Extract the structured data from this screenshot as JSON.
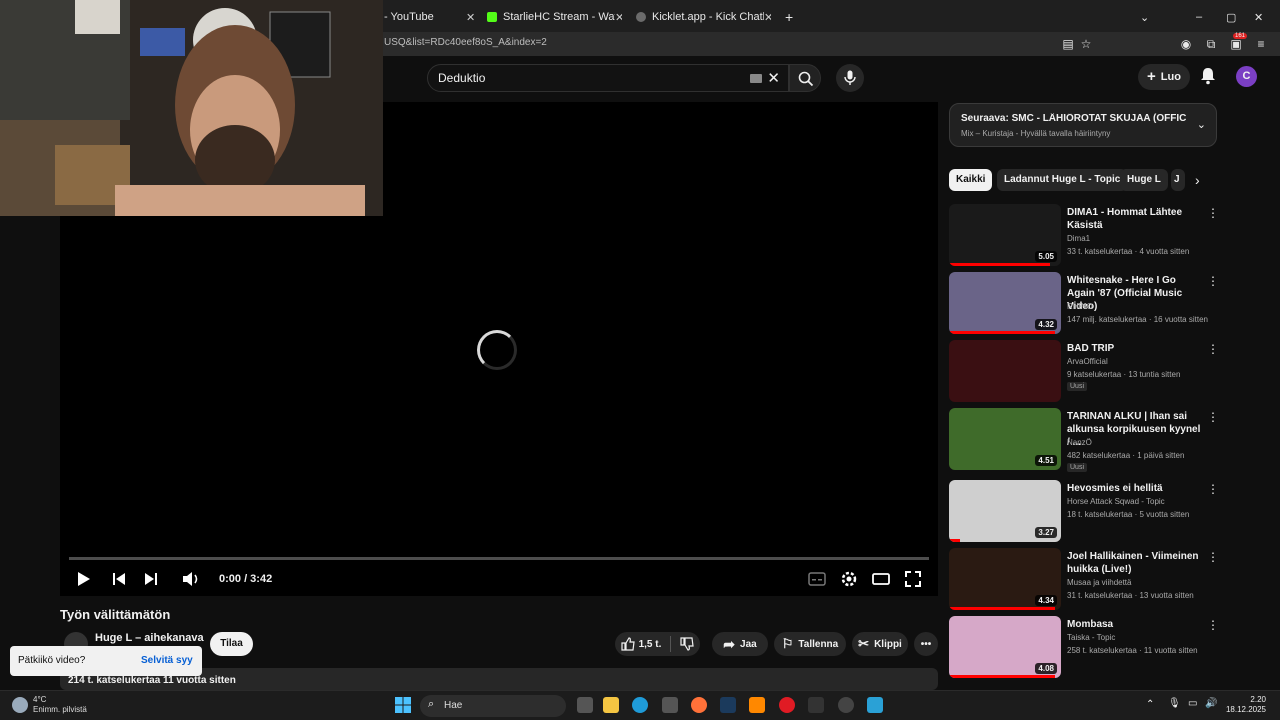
{
  "browser": {
    "tabs": [
      {
        "label": "- YouTube",
        "color": "#ff0000"
      },
      {
        "label": "StarlieHC Stream - Watch Live o",
        "color": "#53fc18"
      },
      {
        "label": "Kicklet.app - Kick Chatbot and C",
        "color": "#6b6b6b"
      }
    ],
    "new_tab": "+",
    "url": "USQ&list=RDc40eef8oS_A&index=2",
    "profile_badge": "161"
  },
  "header": {
    "search_value": "Deduktio",
    "create_label": "Luo",
    "avatar_letter": "C"
  },
  "player": {
    "time": "0:00 / 3:42"
  },
  "video": {
    "title": "Työn välittämätön",
    "channel": "Huge L – aihekanava",
    "subscribe": "Tilaa",
    "likes": "1,5 t.",
    "share": "Jaa",
    "save": "Tallenna",
    "clip": "Klippi",
    "meta": "214 t. katselukertaa  11 vuotta sitten"
  },
  "toast": {
    "question": "Pätkiikö video?",
    "action": "Selvitä syy"
  },
  "upnext": {
    "title": "Seuraava: SMC - LÄHIÖROTAT SKUJAA (OFFICIAL ...",
    "subtitle": "Mix – Kuristaja - Hyvällä tavalla häiriintyny"
  },
  "chips": [
    "Kaikki",
    "Ladannut Huge L - Topic",
    "Huge L",
    "J"
  ],
  "recommendations": [
    {
      "title": "DIMA1 - Hommat Lähtee Käsistä",
      "channel": "Dima1",
      "meta": "33 t. katselukertaa · 4 vuotta sitten",
      "duration": "5.05",
      "badge": "",
      "thumb": "#1a1a1a",
      "progress": 0.9
    },
    {
      "title": "Whitesnake - Here I Go Again '87 (Official Music Video)",
      "channel": "RHINO",
      "meta": "147 milj. katselukertaa · 16 vuotta sitten",
      "duration": "4.32",
      "badge": "",
      "thumb": "#6a6488",
      "progress": 0.95
    },
    {
      "title": "BAD TRIP",
      "channel": "ArvaOfficial",
      "meta": "9 katselukertaa · 13 tuntia sitten",
      "duration": "",
      "badge": "Uusi",
      "thumb": "#3a0f12",
      "progress": 0
    },
    {
      "title": "TARINAN ALKU | Ihan sai alkunsa korpikuusen kyynel / ...",
      "channel": "NanzÖ",
      "meta": "482 katselukertaa · 1 päivä sitten",
      "duration": "4.51",
      "badge": "Uusi",
      "thumb": "#3f6b2a",
      "progress": 0
    },
    {
      "title": "Hevosmies ei hellitä",
      "channel": "Horse Attack Sqwad - Topic",
      "meta": "18 t. katselukertaa · 5 vuotta sitten",
      "duration": "3.27",
      "badge": "",
      "thumb": "#cfcfcf",
      "progress": 0.1
    },
    {
      "title": "Joel Hallikainen - Viimeinen huikka (Live!)",
      "channel": "Musaa ja viihdettä",
      "meta": "31 t. katselukertaa · 13 vuotta sitten",
      "duration": "4.34",
      "badge": "",
      "thumb": "#2a1a12",
      "progress": 0.95
    },
    {
      "title": "Mombasa",
      "channel": "Taiska - Topic",
      "meta": "258 t. katselukertaa · 11 vuotta sitten",
      "duration": "4.08",
      "badge": "",
      "thumb": "#d6a8c8",
      "progress": 0.95
    }
  ],
  "taskbar": {
    "weather_temp": "4°C",
    "weather_desc": "Enimm. pilvistä",
    "search": "Hae",
    "time": "2.20",
    "date": "18.12.2025"
  }
}
